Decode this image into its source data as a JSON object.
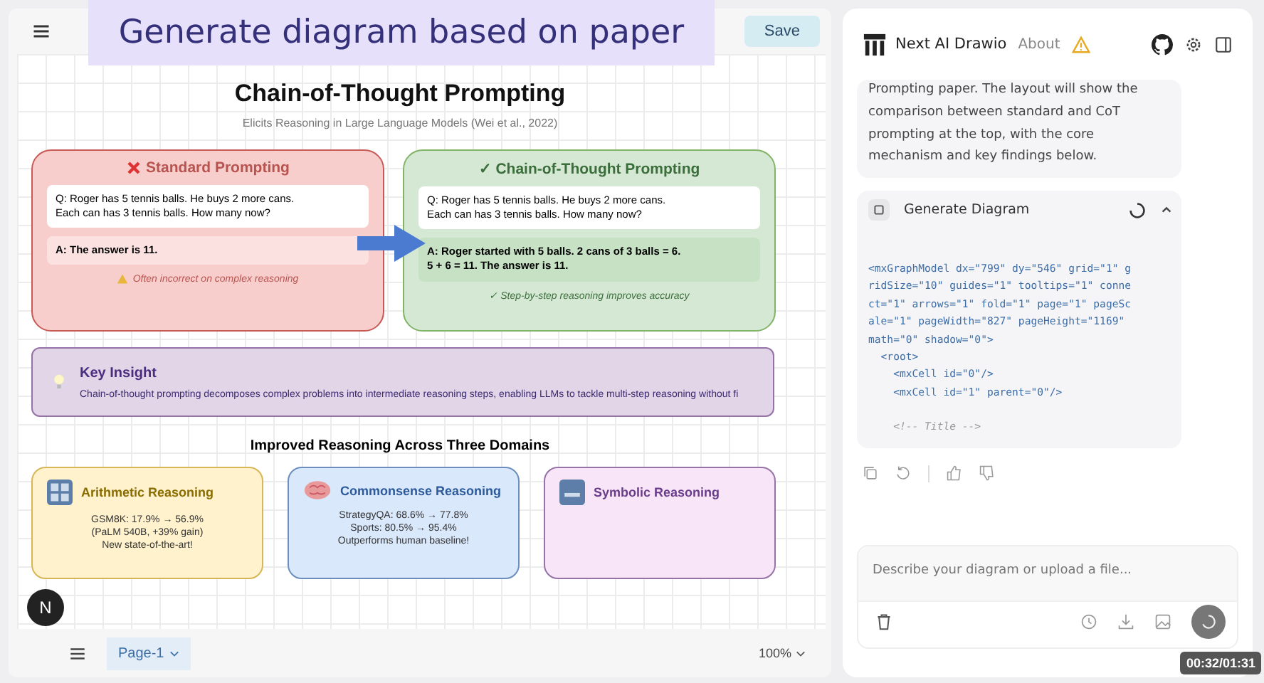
{
  "overlay_caption": "Generate diagram based on paper",
  "editor": {
    "save_button": "Save",
    "diagram": {
      "title": "Chain-of-Thought Prompting",
      "subtitle": "Elicits Reasoning in Large Language Models (Wei et al., 2022)",
      "comparisons": [
        {
          "kind": "standard",
          "heading": "Standard Prompting",
          "question": "Q: Roger has 5 tennis balls. He buys 2 more cans.\nEach can has 3 tennis balls. How many now?",
          "answer": "A: The answer is 11.",
          "note": "Often incorrect on complex reasoning"
        },
        {
          "kind": "cot",
          "heading": "✓ Chain-of-Thought Prompting",
          "question": "Q: Roger has 5 tennis balls. He buys 2 more cans.\nEach can has 3 tennis balls. How many now?",
          "answer": "A: Roger started with 5 balls. 2 cans of 3 balls = 6.\n5 + 6 = 11. The answer is 11.",
          "note": "✓ Step-by-step reasoning improves accuracy"
        }
      ],
      "insight": {
        "title": "Key Insight",
        "text": "Chain-of-thought prompting decomposes complex problems into intermediate reasoning steps, enabling LLMs to tackle multi-step reasoning without fi"
      },
      "domains_heading": "Improved Reasoning Across Three Domains",
      "domains": [
        {
          "kind": "numbers",
          "title": "Arithmetic Reasoning",
          "color": "#fff2cc",
          "lines": [
            "GSM8K: 17.9% → 56.9%",
            "(PaLM 540B, +39% gain)",
            "New state-of-the-art!"
          ]
        },
        {
          "kind": "brain",
          "title": "Commonsense Reasoning",
          "color": "#dae8fc",
          "lines": [
            "StrategyQA: 68.6% → 77.8%",
            "Sports: 80.5% → 95.4%",
            "Outperforms human baseline!"
          ]
        },
        {
          "kind": "letters",
          "title": "Symbolic Reasoning",
          "color": "#f8e6f8"
        }
      ]
    },
    "avatar_letter": "N",
    "pages": [
      {
        "label": "Page-1",
        "selected": true
      }
    ],
    "zoom": "100%"
  },
  "chat": {
    "app_name": "Next AI Drawio",
    "about_link": "About",
    "message": "Prompting paper. The layout will show the comparison between standard and CoT prompting at the top, with the core mechanism and key findings below.",
    "tool_card": {
      "title": "Generate Diagram",
      "expanded": true,
      "code_lines": [
        "<mxGraphModel dx=\"799\" dy=\"546\" grid=\"1\" g",
        "ridSize=\"10\" guides=\"1\" tooltips=\"1\" conne",
        "ct=\"1\" arrows=\"1\" fold=\"1\" page=\"1\" pageSc",
        "ale=\"1\" pageWidth=\"827\" pageHeight=\"1169\"",
        "math=\"0\" shadow=\"0\">",
        "  <root>",
        "    <mxCell id=\"0\"/>",
        "    <mxCell id=\"1\" parent=\"0\"/>"
      ],
      "comment_line": "    <!-- Title -->"
    },
    "input": {
      "placeholder": "Describe your diagram or upload a file..."
    }
  },
  "video": {
    "timestamp": "00:32/01:31"
  }
}
